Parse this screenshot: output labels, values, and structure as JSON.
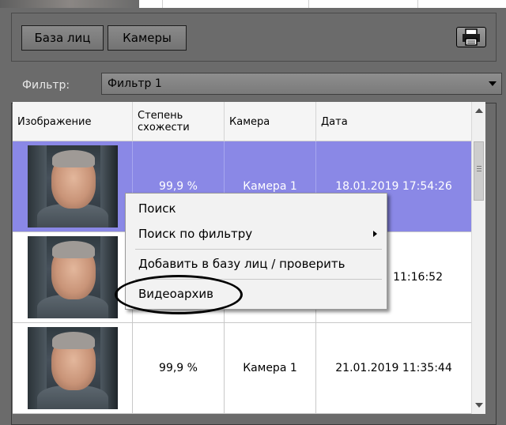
{
  "toolbar": {
    "faces_label": "База лиц",
    "cameras_label": "Камеры"
  },
  "filter": {
    "label": "Фильтр:",
    "value": "Фильтр 1"
  },
  "table": {
    "columns": [
      "Изображение",
      "Степень схожести",
      "Камера",
      "Дата"
    ],
    "rows": [
      {
        "similarity": "99,9 %",
        "camera": "Камера 1",
        "date": "18.01.2019 17:54:26",
        "selected": true
      },
      {
        "similarity": "",
        "camera": "",
        "date": "11:16:52",
        "selected": false
      },
      {
        "similarity": "99,9 %",
        "camera": "Камера 1",
        "date": "21.01.2019 11:35:44",
        "selected": false
      }
    ]
  },
  "context_menu": {
    "items": [
      "Поиск",
      "Поиск по фильтру",
      "Добавить в базу лиц / проверить",
      "Видеоархив"
    ]
  },
  "colors": {
    "selected_row": "#8a88e6",
    "panel_bg": "#6b6b6b"
  }
}
